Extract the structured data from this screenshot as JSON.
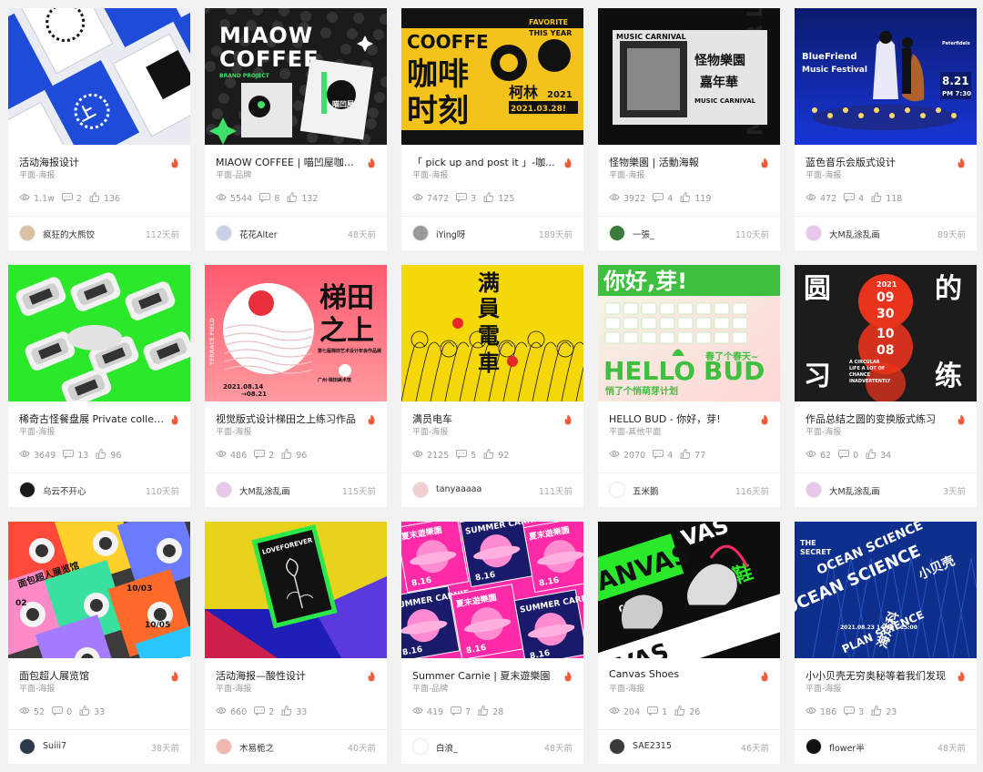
{
  "colors": {
    "hot_red": "#f05a3a",
    "meta_gray": "#999999"
  },
  "icons": {
    "views": "eye-icon",
    "comments": "comment-icon",
    "likes": "thumbs-up-icon",
    "hot": "flame-icon"
  },
  "cards": [
    {
      "title": "活动海报设计",
      "category": "平面-海报",
      "views": "1.1w",
      "comments": "2",
      "likes": "136",
      "author": "疯狂的大熊饺",
      "time": "112天前",
      "poster": {
        "lines": [
          "上",
          ""
        ]
      }
    },
    {
      "title": "MIAOW COFFEE | 喵凹屋咖啡...",
      "category": "平面-品牌",
      "views": "5544",
      "comments": "8",
      "likes": "132",
      "author": "花花Alter",
      "time": "48天前",
      "poster": {
        "lines": [
          "MIAOW",
          "COFFEE",
          "BRAND PROJECT",
          "喵凹屋",
          "咖啡"
        ]
      }
    },
    {
      "title": "「 pick up and post it 」-咖...",
      "category": "平面-海报",
      "views": "7472",
      "comments": "3",
      "likes": "125",
      "author": "iYing呀",
      "time": "189天前",
      "poster": {
        "lines": [
          "COOFFE",
          "咖啡",
          "时刻",
          "柯林",
          "2021",
          "2021.03.28!",
          "FAVORITE",
          "THIS YEAR"
        ]
      }
    },
    {
      "title": "怪物樂園 | 活動海報",
      "category": "平面-海报",
      "views": "3922",
      "comments": "4",
      "likes": "119",
      "author": "一張_",
      "time": "110天前",
      "poster": {
        "lines": [
          "MUSIC CARNIVAL",
          "怪物樂園",
          "嘉年華",
          "MUSIC CARNIVAL",
          "MONSTER LAND"
        ]
      }
    },
    {
      "title": "蓝色音乐会版式设计",
      "category": "平面-海报",
      "views": "472",
      "comments": "4",
      "likes": "118",
      "author": "大M乱涂乱画",
      "time": "89天前",
      "poster": {
        "lines": [
          "BlueFriend",
          "Music Festival",
          "8.21",
          "PM 7:30",
          "Peterfidels"
        ]
      }
    },
    {
      "title": "稀奇古怪餐盘展 Private collec...",
      "category": "平面-海报",
      "views": "3649",
      "comments": "13",
      "likes": "96",
      "author": "乌云不开心",
      "time": "110天前",
      "poster": {
        "lines": []
      }
    },
    {
      "title": "视觉版式设计梯田之上练习作品",
      "category": "平面-海报",
      "views": "486",
      "comments": "2",
      "likes": "96",
      "author": "大M乱涂乱画",
      "time": "115天前",
      "poster": {
        "lines": [
          "梯田",
          "之上",
          "2021.08.14",
          "→08.21",
          "TERRACE FIELD",
          "第七届梯田艺术设计年会作品展",
          "广州·梯田美术馆"
        ]
      }
    },
    {
      "title": "满员电车",
      "category": "平面-海报",
      "views": "2125",
      "comments": "5",
      "likes": "92",
      "author": "tanyaaaaa",
      "time": "111天前",
      "poster": {
        "lines": [
          "满",
          "員",
          "電",
          "車"
        ]
      }
    },
    {
      "title": "HELLO BUD - 你好，芽!",
      "category": "平面-其他平面",
      "views": "2070",
      "comments": "4",
      "likes": "77",
      "author": "五米鹅",
      "time": "116天前",
      "poster": {
        "lines": [
          "你好,芽!",
          "HELLO",
          "BUD",
          "春了个春天~",
          "悄了个悄萌芽计划",
          "HELLO BUD"
        ]
      }
    },
    {
      "title": "作品总结之圆的变换版式练习",
      "category": "平面-海报",
      "views": "62",
      "comments": "0",
      "likes": "34",
      "author": "大M乱涂乱画",
      "time": "3天前",
      "poster": {
        "lines": [
          "圆",
          "的",
          "习",
          "练",
          "2021",
          "09",
          "30",
          "10",
          "08",
          "A CIRCULAR",
          "LIFE A LOT OF",
          "CHANCE",
          "INADVERTENTLY"
        ]
      }
    },
    {
      "title": "面包超人展览馆",
      "category": "平面-海报",
      "views": "52",
      "comments": "0",
      "likes": "33",
      "author": "Suiii7",
      "time": "38天前",
      "poster": {
        "lines": [
          "面包超人展览馆",
          "10/03",
          "10/05",
          "02"
        ]
      }
    },
    {
      "title": "活动海报—酸性设计",
      "category": "平面-海报",
      "views": "660",
      "comments": "2",
      "likes": "33",
      "author": "木易栀之",
      "time": "40天前",
      "poster": {
        "lines": [
          "LOVEFOREVER"
        ]
      }
    },
    {
      "title": "Summer Carnie | 夏末遊樂園",
      "category": "平面-品牌",
      "views": "419",
      "comments": "7",
      "likes": "28",
      "author": "白浪_",
      "time": "48天前",
      "poster": {
        "lines": [
          "夏末遊樂園",
          "SUMMER CARNIE",
          "8.16"
        ]
      }
    },
    {
      "title": "Canvas Shoes",
      "category": "平面-海报",
      "views": "204",
      "comments": "1",
      "likes": "26",
      "author": "SAE2315",
      "time": "46天前",
      "poster": {
        "lines": [
          "CANVAS",
          "VAS",
          "08.21",
          "鞋"
        ]
      }
    },
    {
      "title": "小小贝壳无穷奥秘等着我们发现",
      "category": "平面-海报",
      "views": "186",
      "comments": "3",
      "likes": "23",
      "author": "flower半",
      "time": "48天前",
      "poster": {
        "lines": [
          "OCEAN SCIENCE",
          "OCEAN SCIENCE",
          "PLAN SCIENCE",
          "小贝壳",
          "海洋科",
          "THE",
          "SECRET",
          "2021.08.23 14:00 - 15:00"
        ]
      }
    }
  ]
}
